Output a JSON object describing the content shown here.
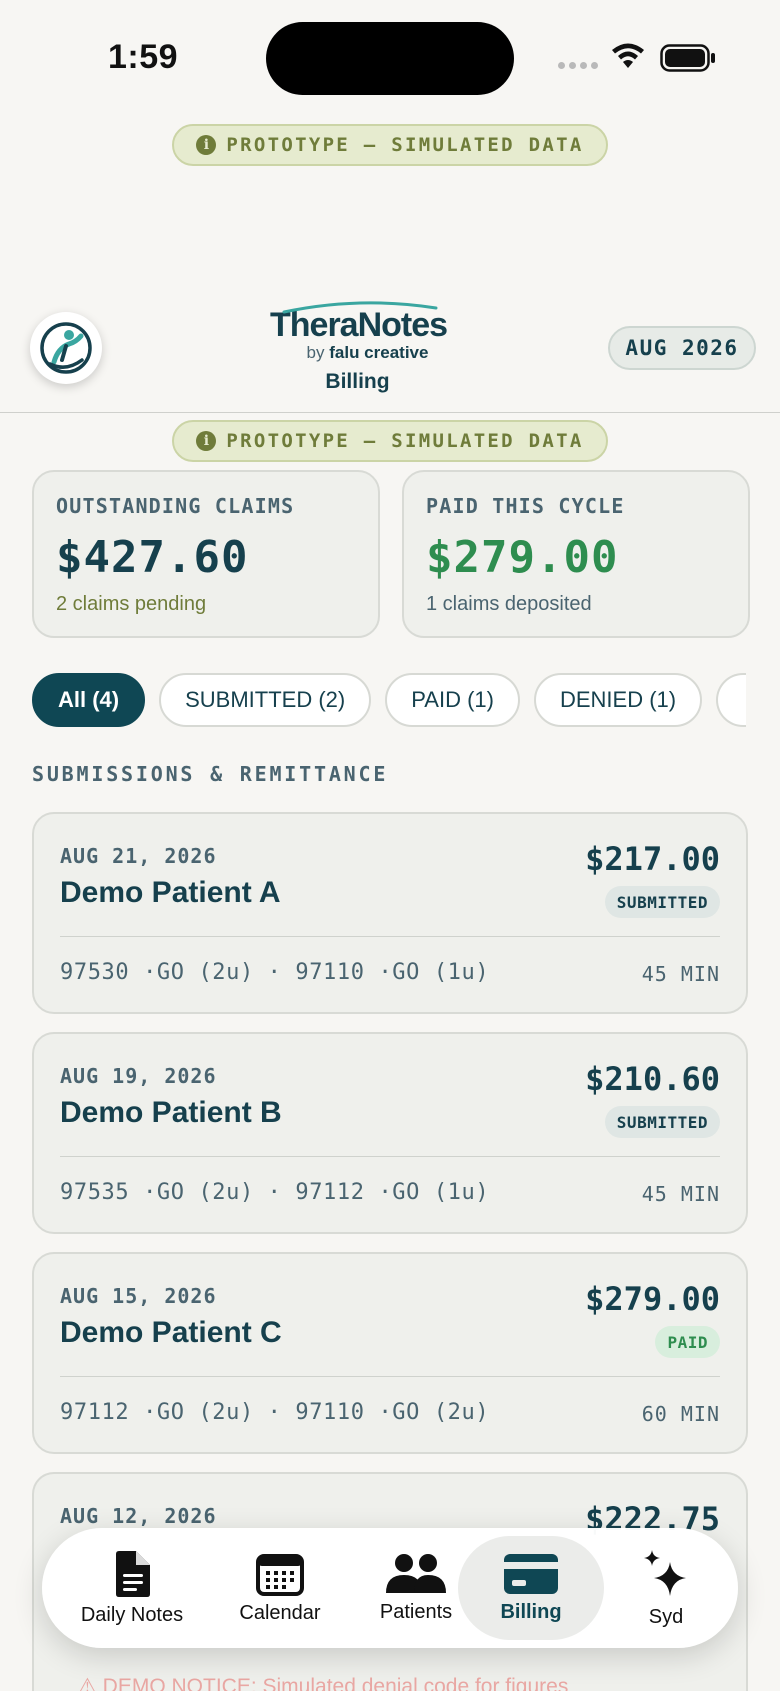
{
  "status_bar": {
    "time": "1:59"
  },
  "banner": {
    "text": "PROTOTYPE — SIMULATED DATA"
  },
  "header": {
    "brand_name": "TheraNotes",
    "brand_by_prefix": "by",
    "brand_by_name": "falu creative",
    "title": "Billing",
    "month": "AUG 2026"
  },
  "stats": {
    "outstanding": {
      "label": "OUTSTANDING CLAIMS",
      "value": "$427.60",
      "sub": "2 claims pending",
      "value_color": "#16404d",
      "sub_color": "#6f7c3a"
    },
    "paid": {
      "label": "PAID THIS CYCLE",
      "value": "$279.00",
      "sub": "1 claims deposited",
      "value_color": "#2e8d4f",
      "sub_color": "#4a6470"
    }
  },
  "filters": [
    {
      "label": "All (4)",
      "active": true
    },
    {
      "label": "SUBMITTED (2)",
      "active": false
    },
    {
      "label": "PAID (1)",
      "active": false
    },
    {
      "label": "DENIED (1)",
      "active": false
    }
  ],
  "section_title": "SUBMISSIONS & REMITTANCE",
  "claims": [
    {
      "date": "AUG 21, 2026",
      "patient": "Demo Patient A",
      "amount": "$217.00",
      "status": "SUBMITTED",
      "codes": "97530 ·GO (2u) · 97110 ·GO (1u)",
      "minutes": "45 MIN"
    },
    {
      "date": "AUG 19, 2026",
      "patient": "Demo Patient B",
      "amount": "$210.60",
      "status": "SUBMITTED",
      "codes": "97535 ·GO (2u) · 97112 ·GO (1u)",
      "minutes": "45 MIN"
    },
    {
      "date": "AUG 15, 2026",
      "patient": "Demo Patient C",
      "amount": "$279.00",
      "status": "PAID",
      "codes": "97112 ·GO (2u) · 97110 ·GO (2u)",
      "minutes": "60 MIN"
    },
    {
      "date": "AUG 12, 2026",
      "patient": "",
      "amount": "$222.75",
      "status": "",
      "codes": "",
      "minutes": ""
    }
  ],
  "nav": {
    "daily_notes": "Daily Notes",
    "calendar": "Calendar",
    "patients": "Patients",
    "billing": "Billing",
    "syd": "Syd"
  },
  "demo_notice": "⚠ DEMO NOTICE: Simulated denial code for figures",
  "colors": {
    "primary": "#0f4754",
    "accent_green": "#2e8d4f",
    "olive": "#6f7c3a"
  }
}
